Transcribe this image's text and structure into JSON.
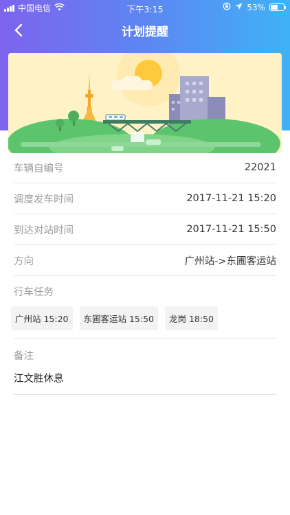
{
  "status_bar": {
    "carrier": "中国电信",
    "time": "下午3:15",
    "battery_percent": "53%",
    "battery_level": 0.53,
    "icons": [
      "signal-icon",
      "wifi-icon",
      "lock-rotation-icon",
      "location-arrow-icon",
      "battery-icon"
    ]
  },
  "nav": {
    "title": "计划提醒",
    "back_icon": "chevron-left-icon"
  },
  "colors": {
    "header_gradient_start": "#7d63ee",
    "header_gradient_end": "#3fb2f6",
    "banner_bg": "#fff2c6",
    "label": "#9b9b9b",
    "value": "#333333",
    "chip_bg": "#f3f3f3"
  },
  "details": [
    {
      "label": "车辆自编号",
      "value": "22021"
    },
    {
      "label": "调度发车时间",
      "value": "2017-11-21 15:20"
    },
    {
      "label": "到达对站时间",
      "value": "2017-11-21 15:50"
    },
    {
      "label": "方向",
      "value": "广州站->东圃客运站"
    }
  ],
  "tasks": {
    "label": "行车任务",
    "items": [
      "广州站 15:20",
      "东圃客运站 15:50",
      "龙岗 18:50"
    ]
  },
  "remark": {
    "label": "备注",
    "text": "江文胜休息"
  }
}
